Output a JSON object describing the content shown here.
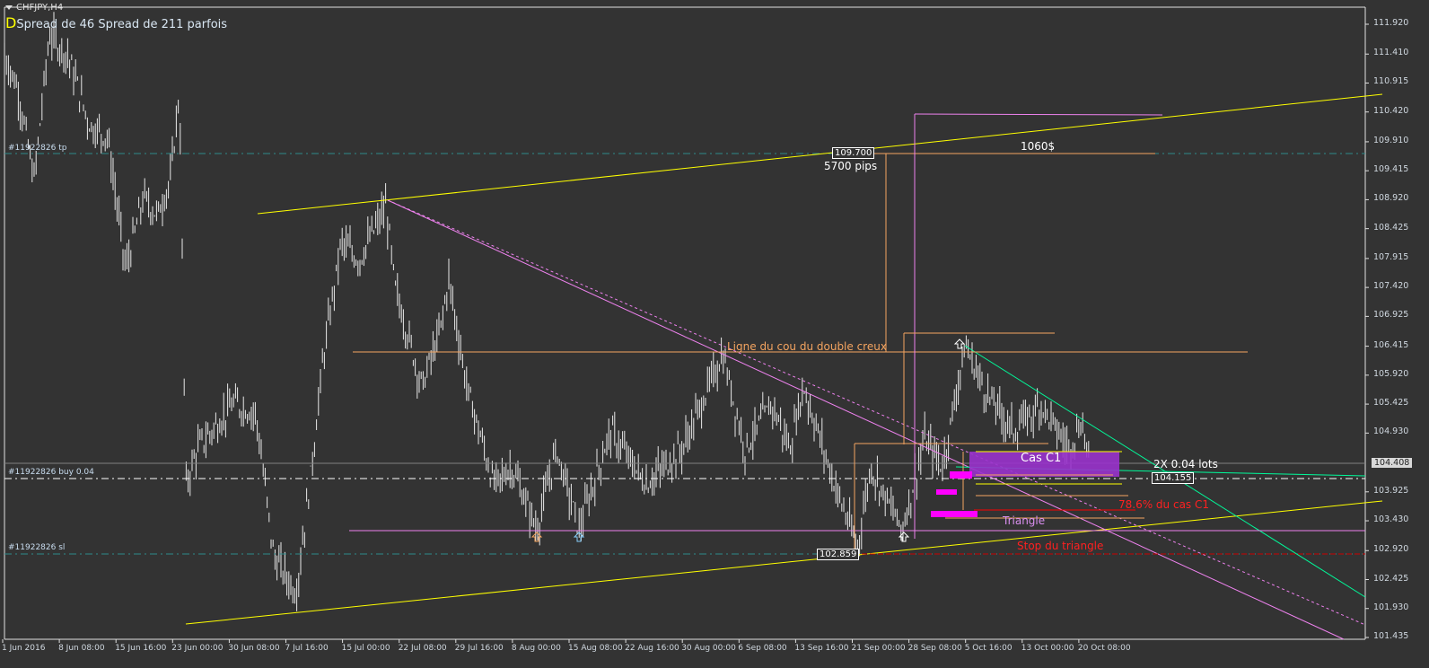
{
  "header": {
    "symbol_timeframe": "CHFJPY,H4",
    "indicator_letter": "D",
    "spread_text_1": "Spread de 46",
    "spread_text_2": "Spread de 211 parfois"
  },
  "orders": {
    "tp_label": "#11922826 tp",
    "buy_label": "#11922826 buy 0.04",
    "sl_label": "#11922826 sl"
  },
  "annotations": {
    "neckline": "Ligne du cou du double creux",
    "profit": "1060$",
    "tp_price": "109.700",
    "pips": "5700 pips",
    "cas_c1": "Cas C1",
    "lots": "2X 0.04 lots",
    "entry_price": "104.155",
    "fib": "78.6% du cas C1",
    "triangle": "Triangle",
    "stop": "Stop du triangle",
    "sl_price": "102.859"
  },
  "current_price": "104.408",
  "price_axis": [
    "111.920",
    "111.410",
    "110.915",
    "110.420",
    "109.910",
    "109.415",
    "108.920",
    "108.425",
    "107.915",
    "107.420",
    "106.925",
    "106.415",
    "105.920",
    "105.425",
    "104.930",
    "103.925",
    "103.430",
    "102.920",
    "102.425",
    "101.930",
    "101.435"
  ],
  "time_axis": [
    "1 Jun 2016",
    "8 Jun 08:00",
    "15 Jun 16:00",
    "23 Jun 00:00",
    "30 Jun 08:00",
    "7 Jul 16:00",
    "15 Jul 00:00",
    "22 Jul 08:00",
    "29 Jul 16:00",
    "8 Aug 00:00",
    "15 Aug 08:00",
    "22 Aug 16:00",
    "30 Aug 00:00",
    "6 Sep 08:00",
    "13 Sep 16:00",
    "21 Sep 00:00",
    "28 Sep 08:00",
    "5 Oct 16:00",
    "13 Oct 00:00",
    "20 Oct 08:00"
  ],
  "colors": {
    "background": "#333333",
    "bars": "#e8e8e8",
    "trendline": "#ffff00",
    "triangle": "#ee82ee",
    "neckline": "#f4a460",
    "stop": "#ff0000",
    "box": "#9932cc",
    "tp_sl": "#2e8b8b",
    "green": "#00fa9a"
  }
}
